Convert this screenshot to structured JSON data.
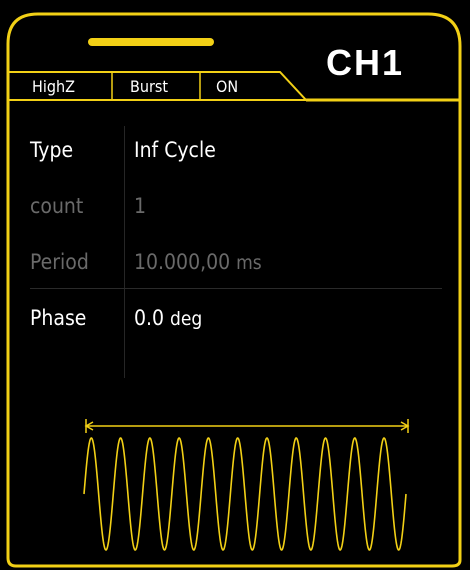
{
  "channel": {
    "title": "CH1"
  },
  "status_bar": {
    "impedance": "HighZ",
    "mode": "Burst",
    "state": "ON"
  },
  "params": [
    {
      "label": "Type",
      "value": "Inf Cycle",
      "unit": "",
      "enabled": true
    },
    {
      "label": "count",
      "value": "1",
      "unit": "",
      "enabled": false
    },
    {
      "label": "Period",
      "value": "10.000,00",
      "unit": "ms",
      "enabled": false
    },
    {
      "label": "Phase",
      "value": "0.0",
      "unit": "deg",
      "enabled": true
    }
  ],
  "waveform": {
    "type": "sine",
    "cycles": 11
  },
  "colors": {
    "accent": "#f2d016",
    "background": "#000000",
    "text": "#ffffff",
    "disabled_text": "#6a6a6a"
  }
}
